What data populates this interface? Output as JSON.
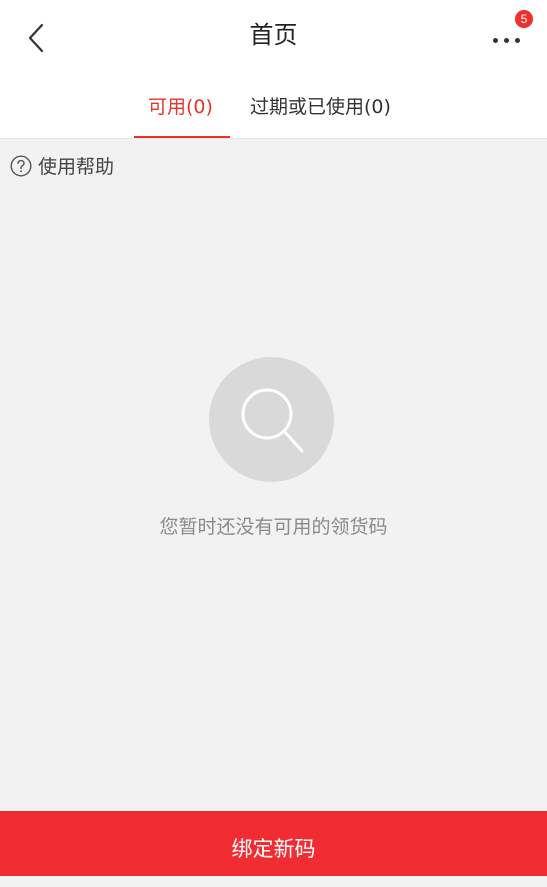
{
  "header": {
    "back_icon": "chevron-left-icon",
    "title": "首页",
    "more_icon": "more-dots-icon",
    "badge_count": "5"
  },
  "tabs": [
    {
      "label": "可用(0)",
      "active": true
    },
    {
      "label": "过期或已使用(0)",
      "active": false
    }
  ],
  "help": {
    "icon": "question-circle-icon",
    "label": "使用帮助"
  },
  "empty_state": {
    "icon": "search-icon",
    "message": "您暂时还没有可用的领货码"
  },
  "footer": {
    "bind_label": "绑定新码"
  },
  "colors": {
    "accent": "#e8342a",
    "button": "#f12c32",
    "background": "#f2f2f2",
    "badge": "#f0302b"
  }
}
